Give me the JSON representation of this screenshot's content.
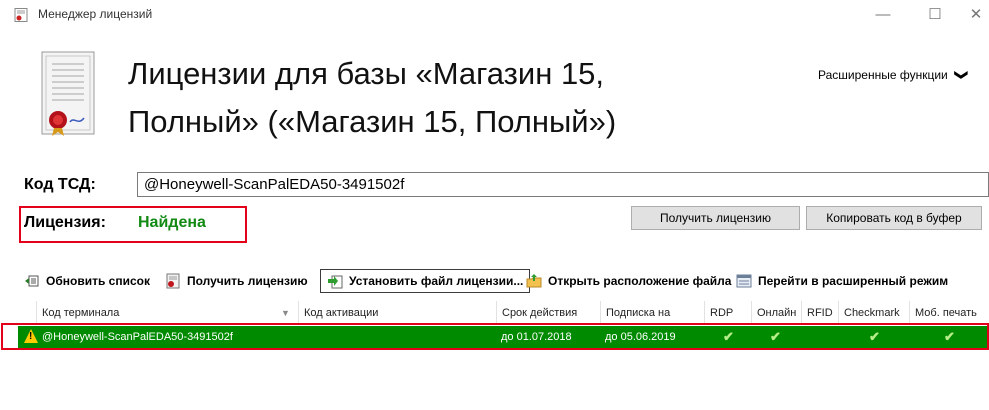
{
  "window": {
    "title": "Менеджер лицензий",
    "min_glyph": "—",
    "max_glyph": "☐",
    "close_glyph": "✕"
  },
  "header": {
    "title": "Лицензии для базы «Магазин 15, Полный» («Магазин 15, Полный»)",
    "ext_menu_label": "Расширенные функции",
    "ext_menu_chevron": "❯"
  },
  "tsd": {
    "label": "Код ТСД:",
    "value": "@Honeywell-ScanPalEDA50-3491502f"
  },
  "license": {
    "label": "Лицензия:",
    "status": "Найдена",
    "status_color": "#138a13",
    "highlight_color": "#e3001b"
  },
  "buttons": {
    "get_license": "Получить лицензию",
    "copy_code": "Копировать код в буфер"
  },
  "toolbar": {
    "refresh": "Обновить список",
    "get_license": "Получить лицензию",
    "install_file": "Установить файл лицензии...",
    "open_location": "Открыть расположение файла",
    "advanced_mode": "Перейти в расширенный режим"
  },
  "table": {
    "columns": [
      "Код терминала",
      "Код активации",
      "Срок действия",
      "Подписка на",
      "RDP",
      "Онлайн",
      "RFID",
      "Checkmark",
      "Моб. печать"
    ],
    "rows": [
      {
        "terminal": "@Honeywell-ScanPalEDA50-3491502f",
        "activation": "",
        "valid_until": "до 01.07.2018",
        "subscription": "до 05.06.2019",
        "rdp": true,
        "online": true,
        "rfid": false,
        "checkmark": true,
        "mobile_print": true,
        "check_glyph": "✔",
        "row_color": "#008a00"
      }
    ]
  }
}
